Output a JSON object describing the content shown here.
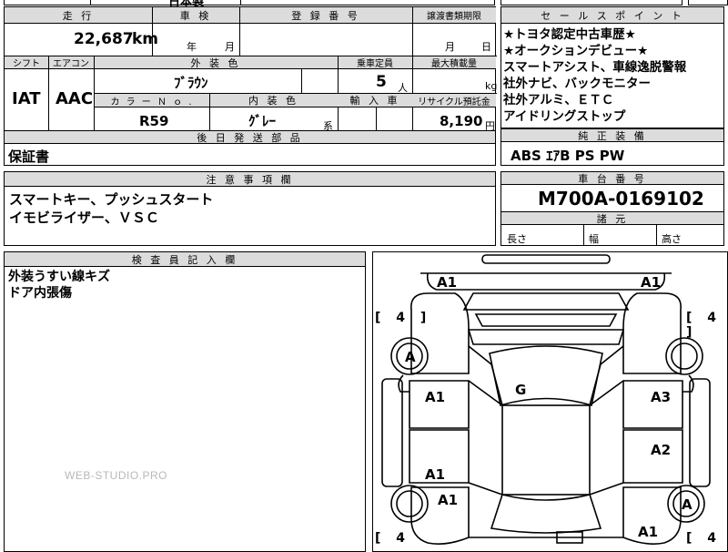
{
  "top_partial": {
    "left": "日本製",
    "mid": ""
  },
  "main_table": {
    "headers": {
      "mileage": "走 行",
      "inspection": "車 検",
      "registration": "登 録 番 号",
      "transfer_deadline": "譲渡書類期限",
      "shift": "シフト",
      "aircon": "エアコン",
      "exterior_color": "外 装 色",
      "capacity": "乗車定員",
      "max_load": "最大積載量",
      "color_no": "カ ラ ー Ｎ ｏ .",
      "interior_color": "内 装 色",
      "import": "輸 入 車",
      "recycle": "リサイクル預託金"
    },
    "mileage_value": "22,687",
    "mileage_unit": "km",
    "inspection_year": "年",
    "inspection_month": "月",
    "transfer_month": "月",
    "transfer_day": "日",
    "shift_value": "IAT",
    "aircon_value": "AAC",
    "exterior_color_value": "ﾌﾞﾗｳﾝ",
    "capacity_value": "5",
    "capacity_unit": "人",
    "max_load_unit": "kg",
    "color_no_value": "R59",
    "interior_color_value": "ｸﾞﾚｰ",
    "interior_color_suffix": "系",
    "recycle_value": "8,190",
    "recycle_unit": "円"
  },
  "sales_points": {
    "header": "セ ー ル ス ポ イ ン ト",
    "lines": [
      "★トヨタ認定中古車歴★",
      "★オークションデビュー★",
      "スマートアシスト、車線逸脱警報",
      "社外ナビ、バックモニター",
      "社外アルミ、ＥＴＣ",
      "アイドリングストップ"
    ]
  },
  "later_parts": {
    "header": "後 日 発 送 部 品",
    "value": "保証書"
  },
  "standard_equipment": {
    "header": "純 正 装 備",
    "value": "ABS ｴｱB PS PW"
  },
  "notes": {
    "header": "注 意 事 項 欄",
    "lines": [
      "スマートキー、プッシュスタート",
      "イモビライザー、ＶＳＣ"
    ]
  },
  "chassis": {
    "header": "車 台 番 号",
    "value": "M700A-0169102"
  },
  "dimensions": {
    "header": "諸 元",
    "length": "長さ",
    "width": "幅",
    "height": "高さ"
  },
  "inspector": {
    "header": "検 査 員 記 入 欄",
    "lines": [
      "外装うすい線キズ",
      "ドア内張傷"
    ]
  },
  "diagram": {
    "labels": {
      "front_left_corner": "A1",
      "front_right_corner": "A1",
      "front_left_wheel": "A",
      "roof": "G",
      "left_front_door": "A1",
      "right_front_door": "A3",
      "left_rear_door": "A1",
      "right_rear_door": "A2",
      "left_rear_quarter": "A1",
      "right_rear_wheel": "A",
      "rear_right_corner": "A1"
    },
    "tire_tl": "[ 4 ]",
    "tire_tr": "[ 4 ]",
    "tire_bl": "[ 4",
    "tire_br": "[ 4"
  },
  "watermark": "WEB-STUDIO.PRO"
}
